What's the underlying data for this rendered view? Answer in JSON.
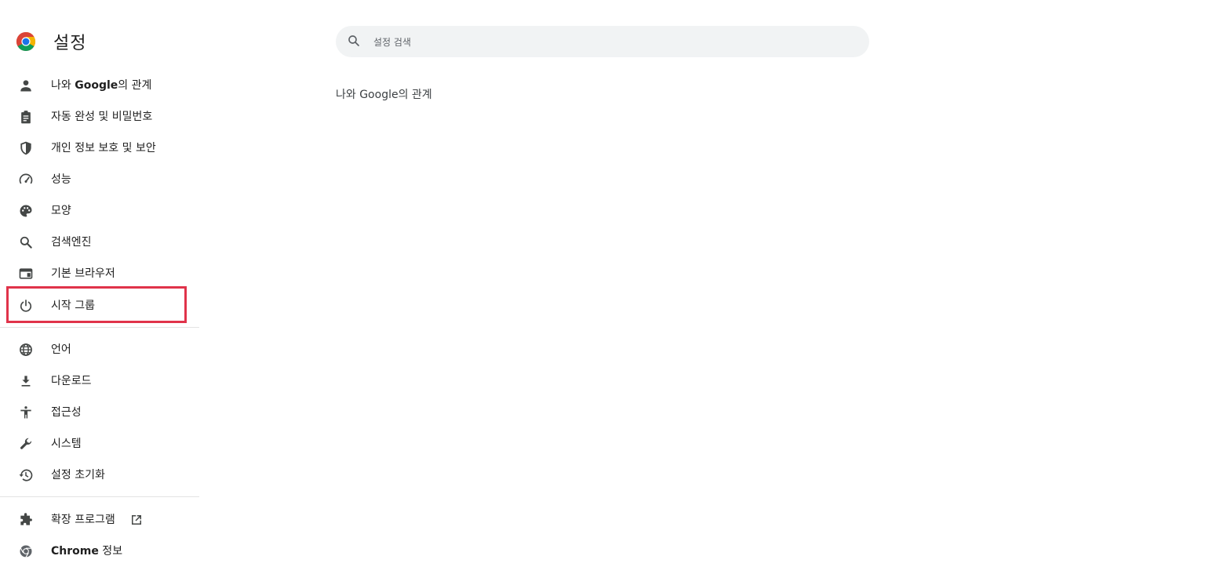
{
  "app": {
    "title": "설정"
  },
  "search": {
    "placeholder": "설정 검색",
    "value": ""
  },
  "main": {
    "section_title": "나와 Google의 관계"
  },
  "sidebar": {
    "items": [
      {
        "pre": "나와 ",
        "bold": "Google",
        "post": "의 관계",
        "icon": "person-icon"
      },
      {
        "label": "자동 완성 및 비밀번호",
        "icon": "clipboard-icon"
      },
      {
        "label": "개인 정보 보호 및 보안",
        "icon": "shield-icon"
      },
      {
        "label": "성능",
        "icon": "speedometer-icon"
      },
      {
        "label": "모양",
        "icon": "palette-icon"
      },
      {
        "label": "검색엔진",
        "icon": "search-icon"
      },
      {
        "label": "기본 브라우저",
        "icon": "browser-window-icon"
      },
      {
        "label": "시작 그룹",
        "icon": "power-icon"
      },
      {
        "label": "언어",
        "icon": "globe-icon"
      },
      {
        "label": "다운로드",
        "icon": "download-icon"
      },
      {
        "label": "접근성",
        "icon": "accessibility-icon"
      },
      {
        "label": "시스템",
        "icon": "wrench-icon"
      },
      {
        "label": "설정 초기화",
        "icon": "restore-icon"
      },
      {
        "label": "확장 프로그램",
        "icon": "puzzle-icon",
        "external_icon": "open-in-new-icon"
      },
      {
        "bold": "Chrome",
        "post": " 정보",
        "icon": "chrome-icon"
      }
    ]
  },
  "colors": {
    "highlight_border": "#e0334a",
    "icon": "#444746",
    "search_bg": "#f1f3f4"
  }
}
